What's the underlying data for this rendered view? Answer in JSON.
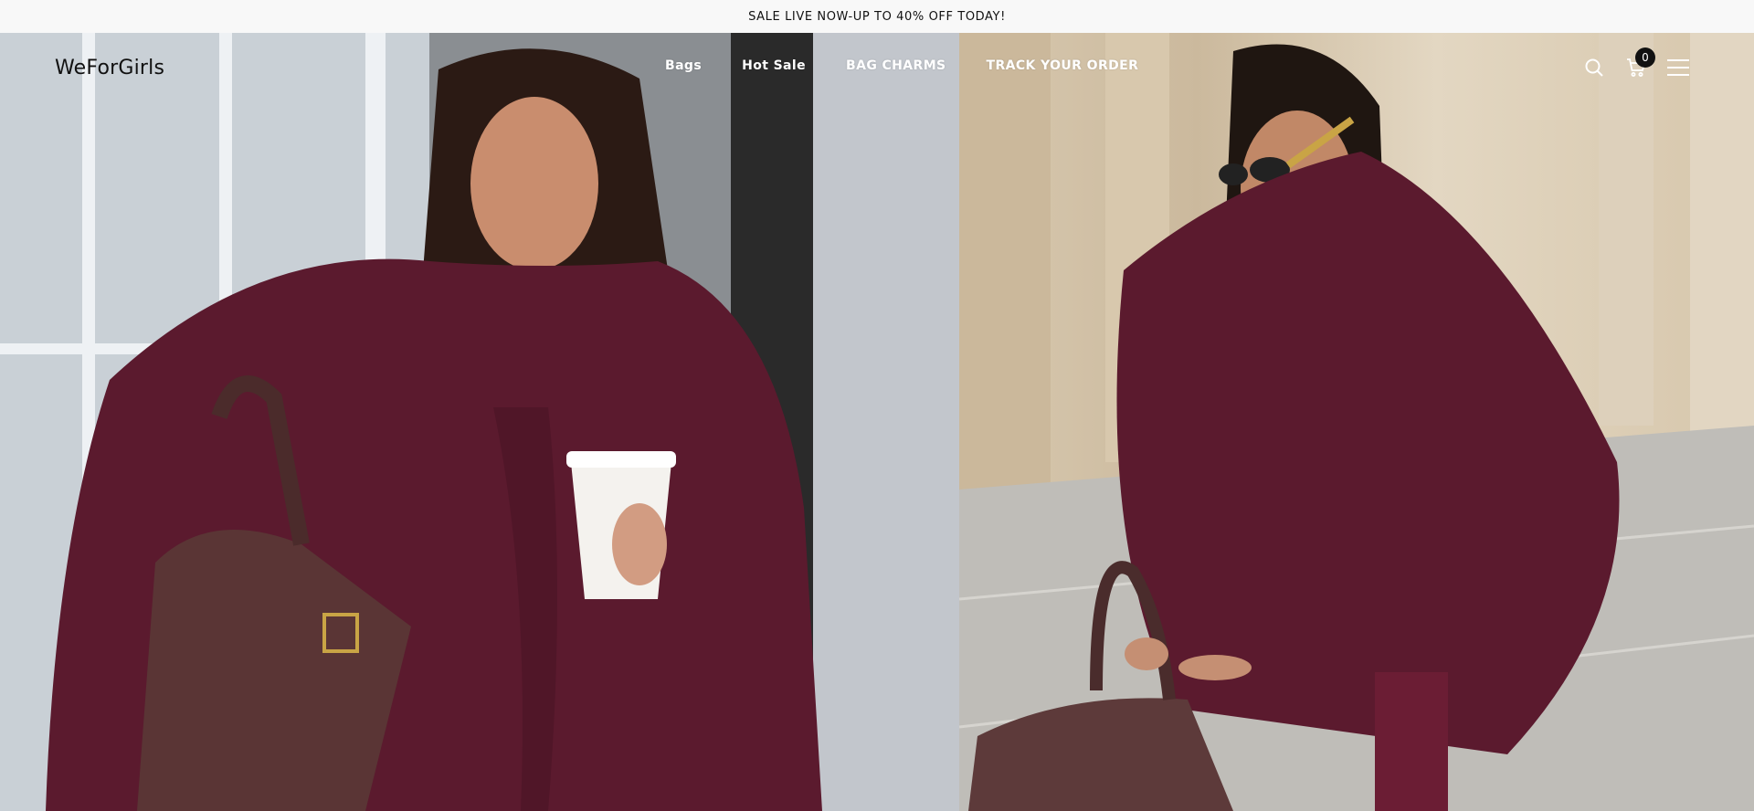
{
  "announcement": {
    "text": "SALE LIVE NOW-UP TO 40% OFF TODAY!"
  },
  "header": {
    "logo": "WeForGirls",
    "nav": [
      {
        "label": "Bags"
      },
      {
        "label": "Hot Sale"
      },
      {
        "label": "BAG CHARMS"
      },
      {
        "label": "TRACK YOUR ORDER"
      }
    ],
    "icons": {
      "search": "search-icon",
      "cart": "cart-icon",
      "menu": "hamburger-menu-icon"
    },
    "cart_count": "0"
  },
  "hero": {
    "images": [
      {
        "name": "hero-image-left"
      },
      {
        "name": "hero-image-right"
      }
    ]
  },
  "colors": {
    "announcement_bg": "#f8f8f8",
    "nav_text": "#ffffff",
    "coat": "#5b1a2e",
    "bag": "#5a3535",
    "badge_bg": "#111111"
  }
}
